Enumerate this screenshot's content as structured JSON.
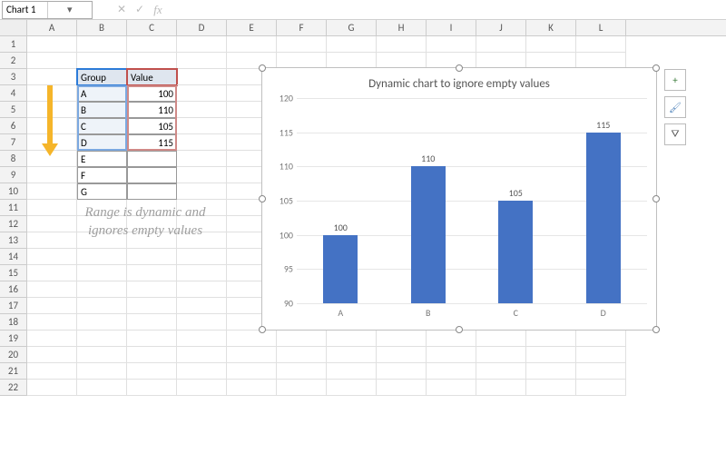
{
  "name_box": "Chart 1",
  "columns": [
    "A",
    "B",
    "C",
    "D",
    "E",
    "F",
    "G",
    "H",
    "I",
    "J",
    "K",
    "L"
  ],
  "row_count": 22,
  "table": {
    "headers": {
      "group": "Group",
      "value": "Value"
    },
    "rows": [
      {
        "group": "A",
        "value": 100
      },
      {
        "group": "B",
        "value": 110
      },
      {
        "group": "C",
        "value": 105
      },
      {
        "group": "D",
        "value": 115
      },
      {
        "group": "E",
        "value": ""
      },
      {
        "group": "F",
        "value": ""
      },
      {
        "group": "G",
        "value": ""
      }
    ]
  },
  "annotation": "Range is dynamic and ignores empty values",
  "chart_side_icons": {
    "plus": "+",
    "brush": "🖌",
    "funnel": "⛛"
  },
  "chart_data": {
    "type": "bar",
    "title": "Dynamic chart to ignore empty values",
    "categories": [
      "A",
      "B",
      "C",
      "D"
    ],
    "values": [
      100,
      110,
      105,
      115
    ],
    "xlabel": "",
    "ylabel": "",
    "ylim": [
      90,
      120
    ],
    "yticks": [
      90,
      95,
      100,
      105,
      110,
      115,
      120
    ],
    "bar_color": "#4472c4",
    "data_labels": true
  }
}
